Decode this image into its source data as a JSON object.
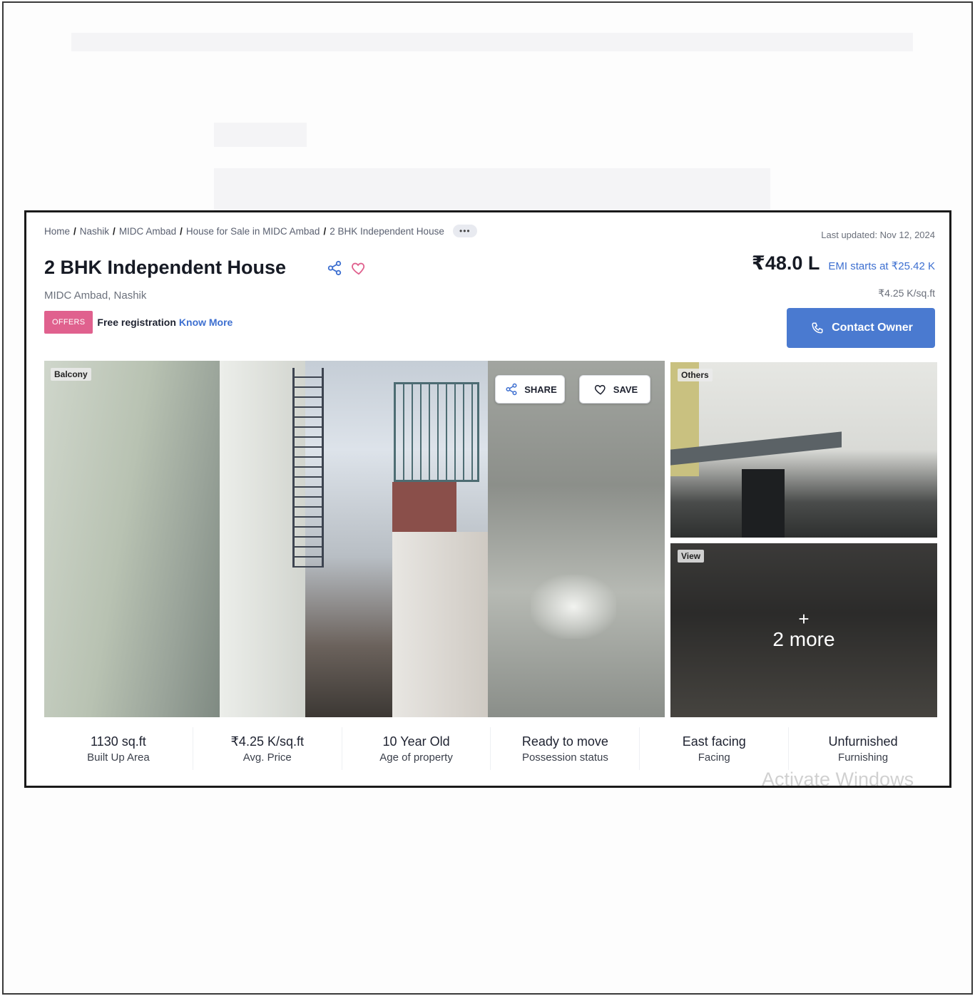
{
  "breadcrumb": {
    "items": [
      "Home",
      "Nashik",
      "MIDC Ambad",
      "House for Sale in MIDC Ambad",
      "2 BHK Independent House"
    ],
    "separator": "/",
    "more": "•••"
  },
  "last_updated": "Last updated: Nov 12, 2024",
  "listing": {
    "title": "2 BHK Independent House",
    "location": "MIDC Ambad, Nashik",
    "price": "₹48.0 L",
    "emi": "EMI starts at ₹25.42 K",
    "price_per_sqft": "₹4.25 K/sq.ft"
  },
  "offer": {
    "badge": "OFFERS",
    "text": "Free registration",
    "link": "Know More"
  },
  "contact": {
    "label": "Contact Owner"
  },
  "gallery": {
    "main_tag": "Balcony",
    "share_label": "SHARE",
    "save_label": "SAVE",
    "side1_tag": "Others",
    "side2_tag": "View",
    "more_plus": "+",
    "more_label": "2 more"
  },
  "stats": [
    {
      "value": "1130 sq.ft",
      "label": "Built Up Area"
    },
    {
      "value": "₹4.25 K/sq.ft",
      "label": "Avg. Price"
    },
    {
      "value": "10 Year Old",
      "label": "Age of property"
    },
    {
      "value": "Ready to move",
      "label": "Possession status"
    },
    {
      "value": "East facing",
      "label": "Facing"
    },
    {
      "value": "Unfurnished",
      "label": "Furnishing"
    }
  ],
  "watermark": "Activate Windows",
  "colors": {
    "accent": "#4a7ad0",
    "link": "#3d6fd0",
    "offer_badge": "#e0618e",
    "heart": "#e0618e"
  },
  "icons": {
    "share": "share-icon",
    "favorite": "heart-icon",
    "phone": "phone-icon",
    "more": "ellipsis-icon"
  }
}
